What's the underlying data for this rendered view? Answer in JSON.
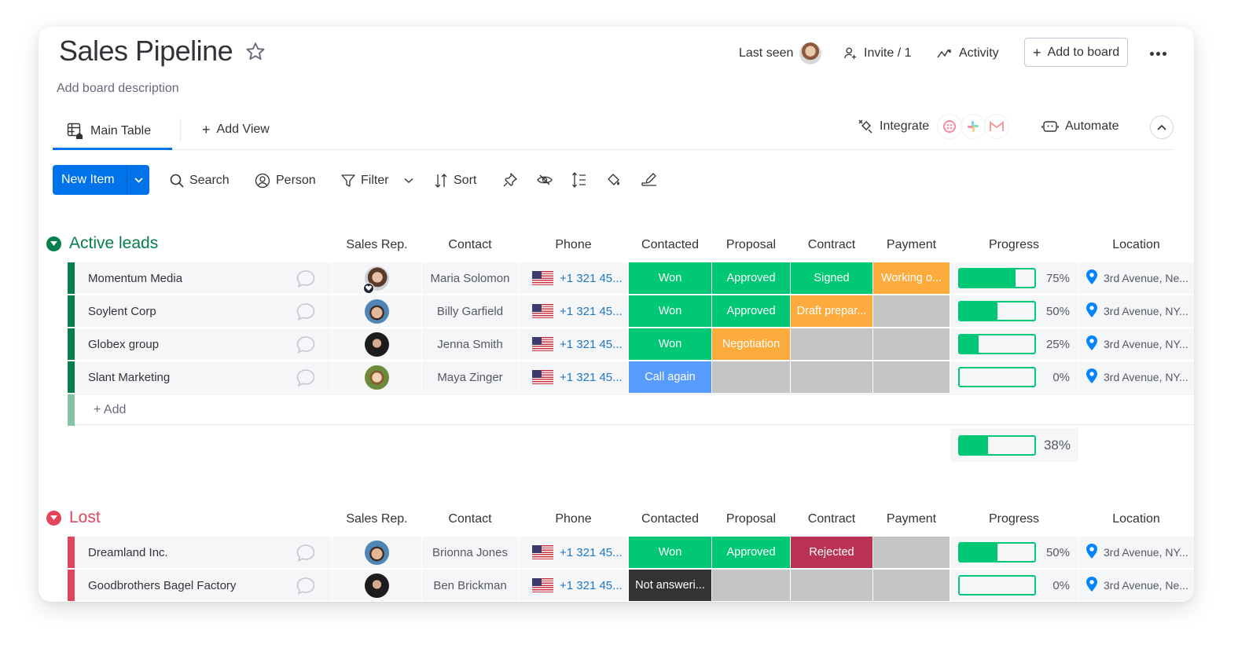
{
  "board": {
    "title": "Sales Pipeline",
    "description": "Add board description",
    "last_seen_label": "Last seen",
    "invite_label": "Invite / 1",
    "activity_label": "Activity",
    "add_to_board_label": "Add to board"
  },
  "views": {
    "main_tab": "Main Table",
    "add_view": "Add View",
    "integrate": "Integrate",
    "automate": "Automate"
  },
  "toolbar": {
    "new_item": "New Item",
    "search": "Search",
    "person": "Person",
    "filter": "Filter",
    "sort": "Sort"
  },
  "columns": {
    "sales_rep": "Sales Rep.",
    "contact": "Contact",
    "phone": "Phone",
    "contacted": "Contacted",
    "proposal": "Proposal",
    "contract": "Contract",
    "payment": "Payment",
    "progress": "Progress",
    "location": "Location"
  },
  "colors": {
    "won": "#00c875",
    "working": "#fdab3d",
    "call_again": "#579bfc",
    "rejected": "#bb3354",
    "not_answering": "#333333",
    "empty": "#c4c4c4",
    "active_group": "#037f4c",
    "lost_group": "#e2445c",
    "primary": "#0073ea"
  },
  "groups": [
    {
      "name": "Active leads",
      "color": "#037f4c",
      "add_label": "+ Add",
      "summary_progress": 38,
      "summary_label": "38%",
      "rows": [
        {
          "name": "Momentum Media",
          "contact": "Maria Solomon",
          "phone": "+1 321 45...",
          "contacted": "Won",
          "proposal": "Approved",
          "contract": "Signed",
          "payment": "Working o...",
          "progress": 75,
          "progress_label": "75%",
          "location": "3rd Avenue, Ne..."
        },
        {
          "name": "Soylent Corp",
          "contact": "Billy Garfield",
          "phone": "+1 321 45...",
          "contacted": "Won",
          "proposal": "Approved",
          "contract": "Draft prepar...",
          "payment": "",
          "progress": 50,
          "progress_label": "50%",
          "location": "3rd Avenue, NY..."
        },
        {
          "name": "Globex group",
          "contact": "Jenna Smith",
          "phone": "+1 321 45...",
          "contacted": "Won",
          "proposal": "Negotiation",
          "contract": "",
          "payment": "",
          "progress": 25,
          "progress_label": "25%",
          "location": "3rd Avenue, NY..."
        },
        {
          "name": "Slant Marketing",
          "contact": "Maya Zinger",
          "phone": "+1 321 45...",
          "contacted": "Call again",
          "proposal": "",
          "contract": "",
          "payment": "",
          "progress": 0,
          "progress_label": "0%",
          "location": "3rd Avenue, NY..."
        }
      ]
    },
    {
      "name": "Lost",
      "color": "#e2445c",
      "rows": [
        {
          "name": "Dreamland Inc.",
          "contact": "Brionna Jones",
          "phone": "+1 321 45...",
          "contacted": "Won",
          "proposal": "Approved",
          "contract": "Rejected",
          "payment": "",
          "progress": 50,
          "progress_label": "50%",
          "location": "3rd Avenue, NY..."
        },
        {
          "name": "Goodbrothers Bagel Factory",
          "contact": "Ben Brickman",
          "phone": "+1 321 45...",
          "contacted": "Not answeri...",
          "proposal": "",
          "contract": "",
          "payment": "",
          "progress": 0,
          "progress_label": "0%",
          "location": "3rd Avenue, Ne..."
        }
      ]
    }
  ]
}
